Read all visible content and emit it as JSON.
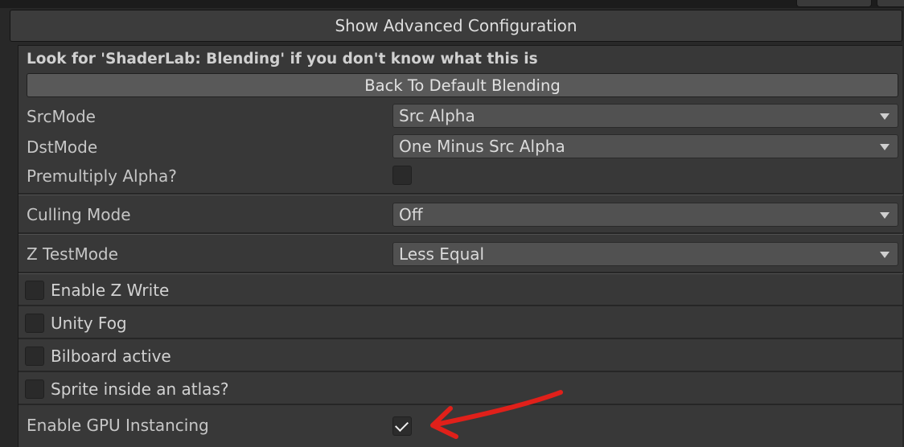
{
  "advanced_button": {
    "label": "Show Advanced Configuration"
  },
  "blending": {
    "info": "Look for 'ShaderLab: Blending' if you don't know what this is",
    "default_button": "Back To Default Blending",
    "src_mode": {
      "label": "SrcMode",
      "value": "Src Alpha"
    },
    "dst_mode": {
      "label": "DstMode",
      "value": "One Minus Src Alpha"
    },
    "premultiply": {
      "label": "Premultiply Alpha?",
      "checked": false
    }
  },
  "culling": {
    "label": "Culling Mode",
    "value": "Off"
  },
  "ztest": {
    "label": "Z TestMode",
    "value": "Less Equal"
  },
  "toggles": [
    {
      "label": "Enable Z Write",
      "checked": false
    },
    {
      "label": "Unity Fog",
      "checked": false
    },
    {
      "label": "Bilboard active",
      "checked": false
    },
    {
      "label": "Sprite inside an atlas?",
      "checked": false
    }
  ],
  "gpu_instancing": {
    "label": "Enable GPU Instancing",
    "checked": true
  },
  "colors": {
    "background": "#282828",
    "panel": "#383838",
    "dropdown": "#515151",
    "annotation_arrow": "#e0201a"
  },
  "icons": {
    "dropdown_arrow": "chevron-down-icon",
    "checkmark": "check-icon",
    "annotation": "red-arrow-icon"
  }
}
